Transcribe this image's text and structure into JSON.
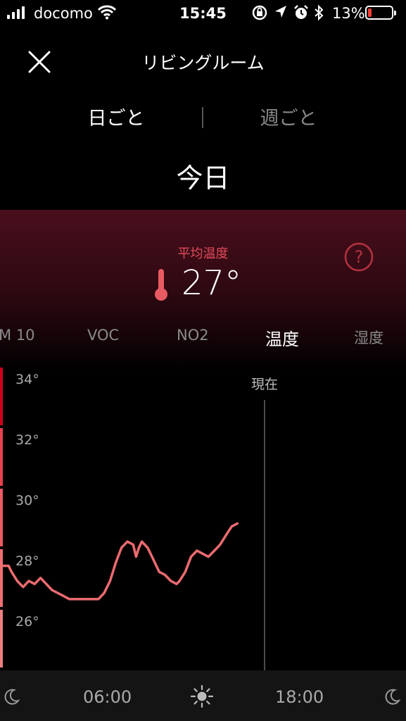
{
  "status": {
    "carrier": "docomo",
    "time": "15:45",
    "battery": "13%"
  },
  "header": {
    "title": "リビングルーム"
  },
  "segments": {
    "day": "日ごと",
    "week": "週ごと"
  },
  "period": "今日",
  "average": {
    "label": "平均温度",
    "value": "27°"
  },
  "tabs": [
    "M 10",
    "VOC",
    "NO2",
    "温度",
    "湿度"
  ],
  "now_label": "現在",
  "icons": {
    "close": "close-icon",
    "help": "help-icon",
    "thermometer": "thermometer-icon",
    "moon": "moon-icon",
    "sun": "sun-icon"
  },
  "colors": {
    "accent": "#e85a62",
    "panel": "#4a0f1c"
  },
  "chart_data": {
    "type": "line",
    "ylim": [
      24,
      35
    ],
    "y_ticks": [
      "34°",
      "32°",
      "30°",
      "28°",
      "26°"
    ],
    "x_labels": [
      "06:00",
      "18:00"
    ],
    "series": [
      {
        "values": [
          [
            0,
            27.8
          ],
          [
            0.33,
            27.8
          ],
          [
            0.5,
            27.6
          ],
          [
            0.83,
            27.3
          ],
          [
            1.17,
            27.1
          ],
          [
            1.5,
            27.3
          ],
          [
            1.83,
            27.2
          ],
          [
            2.17,
            27.4
          ],
          [
            2.5,
            27.2
          ],
          [
            2.83,
            27.0
          ],
          [
            3.17,
            26.9
          ],
          [
            3.5,
            26.8
          ],
          [
            3.83,
            26.7
          ],
          [
            4.17,
            26.7
          ],
          [
            4.5,
            26.7
          ],
          [
            4.83,
            26.7
          ],
          [
            5.17,
            26.7
          ],
          [
            5.5,
            26.7
          ],
          [
            5.83,
            26.9
          ],
          [
            6.17,
            27.3
          ],
          [
            6.5,
            27.9
          ],
          [
            6.83,
            28.4
          ],
          [
            7.17,
            28.6
          ],
          [
            7.5,
            28.5
          ],
          [
            7.67,
            28.1
          ],
          [
            7.83,
            28.4
          ],
          [
            8.0,
            28.6
          ],
          [
            8.33,
            28.4
          ],
          [
            8.67,
            28.0
          ],
          [
            9.0,
            27.6
          ],
          [
            9.33,
            27.5
          ],
          [
            9.67,
            27.3
          ],
          [
            10.0,
            27.2
          ],
          [
            10.17,
            27.3
          ],
          [
            10.5,
            27.6
          ],
          [
            10.83,
            28.1
          ],
          [
            11.17,
            28.3
          ],
          [
            11.5,
            28.2
          ],
          [
            11.83,
            28.1
          ],
          [
            12.17,
            28.3
          ],
          [
            12.5,
            28.5
          ],
          [
            12.83,
            28.8
          ],
          [
            13.17,
            29.1
          ],
          [
            13.5,
            29.2
          ]
        ]
      }
    ]
  }
}
